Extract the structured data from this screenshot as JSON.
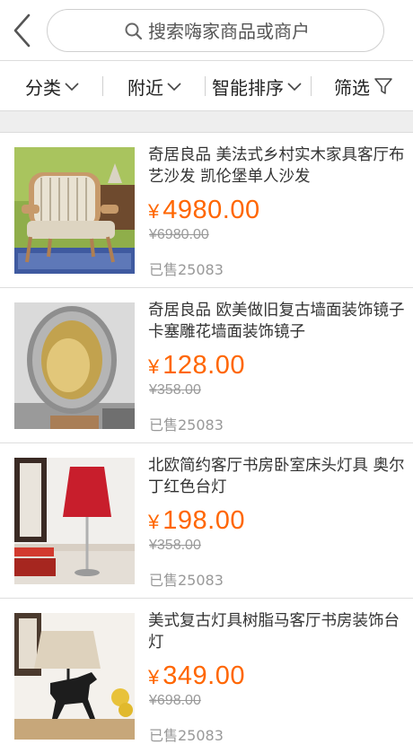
{
  "search": {
    "placeholder": "搜索嗨家商品或商户"
  },
  "filters": [
    {
      "label": "分类",
      "icon": "chevron-down-icon"
    },
    {
      "label": "附近",
      "icon": "chevron-down-icon"
    },
    {
      "label": "智能排序",
      "icon": "chevron-down-icon"
    },
    {
      "label": "筛选",
      "icon": "filter-funnel-icon"
    }
  ],
  "colors": {
    "price": "#ff6600",
    "muted": "#999999",
    "divider": "#dcdcdc",
    "gap": "#eeeeee"
  },
  "products": [
    {
      "title": "奇居良品 美法式乡村实木家具客厅布艺沙发 凯伦堡单人沙发",
      "currency": "¥",
      "price": "4980.00",
      "original_price": "¥6980.00",
      "sold": "已售25083",
      "image": "armchair-photo"
    },
    {
      "title": "奇居良品 欧美做旧复古墙面装饰镜子卡塞雕花墙面装饰镜子",
      "currency": "¥",
      "price": "128.00",
      "original_price": "¥358.00",
      "sold": "已售25083",
      "image": "ornate-mirror-photo"
    },
    {
      "title": "北欧简约客厅书房卧室床头灯具 奥尔丁红色台灯",
      "currency": "¥",
      "price": "198.00",
      "original_price": "¥358.00",
      "sold": "已售25083",
      "image": "red-table-lamp-photo"
    },
    {
      "title": "美式复古灯具树脂马客厅书房装饰台灯",
      "currency": "¥",
      "price": "349.00",
      "original_price": "¥698.00",
      "sold": "已售25083",
      "image": "horse-table-lamp-photo"
    }
  ]
}
